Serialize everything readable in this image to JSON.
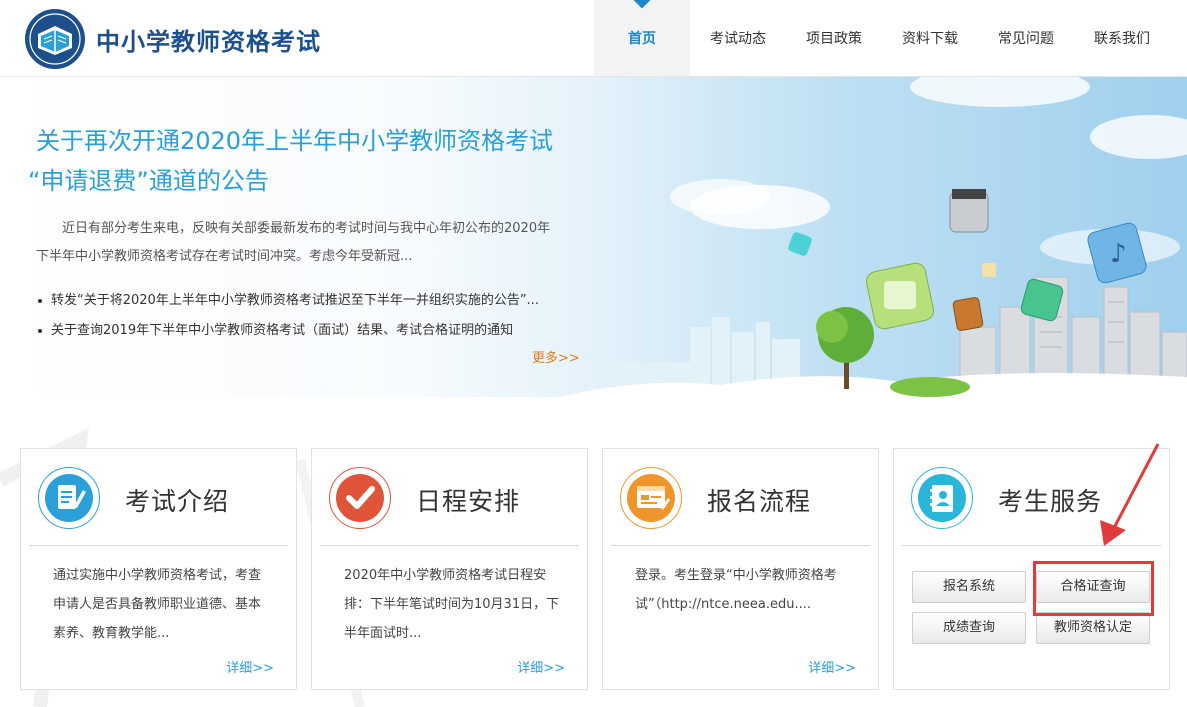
{
  "site": {
    "title": "中小学教师资格考试"
  },
  "nav": [
    {
      "label": "首页",
      "active": true
    },
    {
      "label": "考试动态"
    },
    {
      "label": "项目政策"
    },
    {
      "label": "资料下载"
    },
    {
      "label": "常见问题"
    },
    {
      "label": "联系我们"
    }
  ],
  "banner": {
    "headline_1": "关于再次开通2020年上半年中小学教师资格考试",
    "headline_2": "“申请退费”通道的公告",
    "summary": "近日有部分考生来电，反映有关部委最新发布的考试时间与我中心年初公布的2020年下半年中小学教师资格考试存在考试时间冲突。考虑今年受新冠...",
    "news": [
      "转发“关于将2020年上半年中小学教师资格考试推迟至下半年一并组织实施的公告”...",
      "关于查询2019年下半年中小学教师资格考试（面试）结果、考试合格证明的通知"
    ],
    "more_label": "更多>>"
  },
  "cards": [
    {
      "title": "考试介绍",
      "body": "通过实施中小学教师资格考试，考查申请人是否具备教师职业道德、基本素养、教育教学能...",
      "detail": "详细>>"
    },
    {
      "title": "日程安排",
      "body": "2020年中小学教师资格考试日程安排：下半年笔试时间为10月31日，下半年面试时...",
      "detail": "详细>>"
    },
    {
      "title": "报名流程",
      "body": "登录。考生登录“中小学教师资格考试”（http://ntce.neea.edu....",
      "detail": "详细>>"
    },
    {
      "title": "考生服务"
    }
  ],
  "services": [
    "报名系统",
    "合格证查询",
    "成绩查询",
    "教师资格认定"
  ],
  "colors": {
    "primary": "#2a9fd8",
    "brand": "#1d4f8a",
    "accent_orange": "#e07a1f",
    "card_red": "#e0553a",
    "highlight": "#e23b3b"
  }
}
